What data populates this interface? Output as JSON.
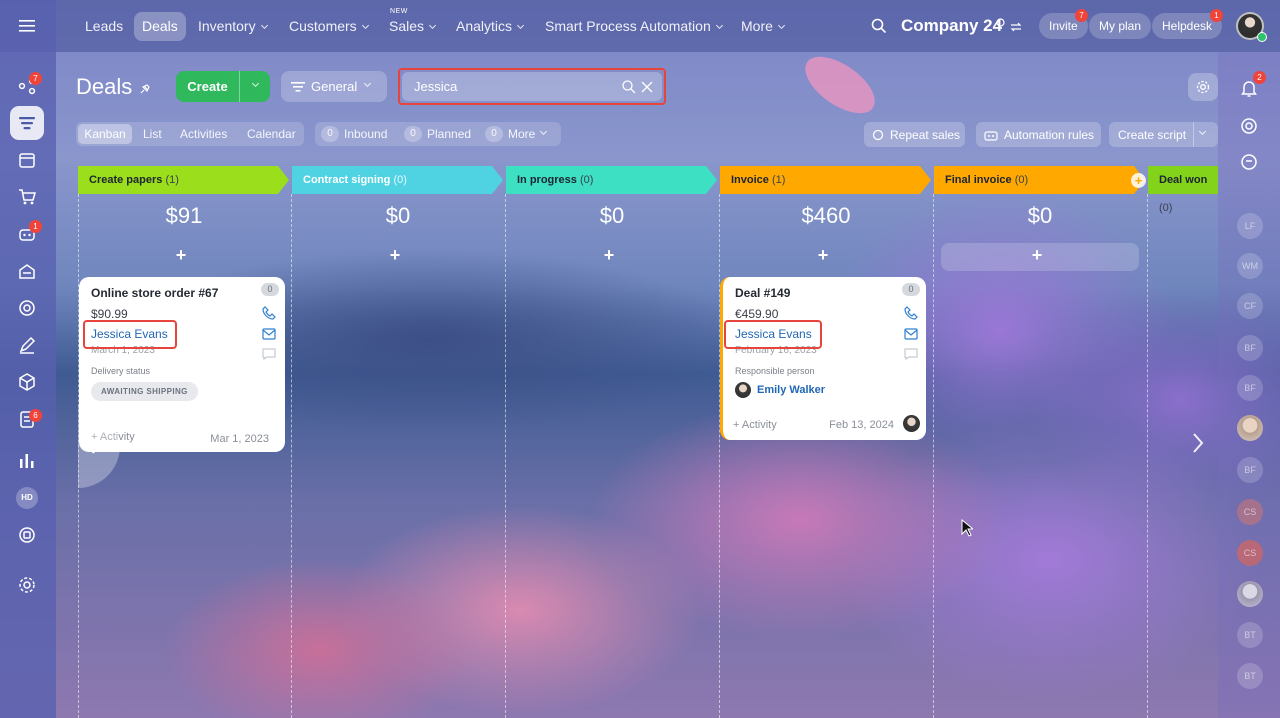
{
  "nav": {
    "items": [
      "Leads",
      "Deals",
      "Inventory",
      "Customers",
      "Sales",
      "Analytics",
      "Smart Process Automation",
      "More"
    ],
    "new_tag": "NEW"
  },
  "company": {
    "name": "Company 24",
    "invite": "Invite",
    "invite_badge": "7",
    "myplan": "My plan",
    "helpdesk": "Helpdesk",
    "helpdesk_badge": "1"
  },
  "sidebar": {
    "badges": {
      "activity": "7",
      "robots": "1",
      "tasks": "6"
    },
    "hd": "HD"
  },
  "page": {
    "title": "Deals",
    "create": "Create",
    "filter": "General",
    "search_value": "Jessica"
  },
  "views": {
    "tabs": [
      "Kanban",
      "List",
      "Activities",
      "Calendar"
    ],
    "counters": [
      {
        "count": "0",
        "label": "Inbound"
      },
      {
        "count": "0",
        "label": "Planned"
      },
      {
        "count": "0",
        "label": "More"
      }
    ]
  },
  "actions": {
    "repeat": "Repeat sales",
    "automation": "Automation rules",
    "script": "Create script"
  },
  "notif_badge": "2",
  "stages": [
    {
      "name": "Create papers",
      "count": "(1)",
      "color": "#9bde1c",
      "sum": "$91"
    },
    {
      "name": "Contract signing",
      "count": "(0)",
      "color": "#4fd3e2",
      "sum": "$0"
    },
    {
      "name": "In progress",
      "count": "(0)",
      "color": "#3ee0c4",
      "sum": "$0"
    },
    {
      "name": "Invoice",
      "count": "(1)",
      "color": "#ffa800",
      "sum": "$460"
    },
    {
      "name": "Final invoice",
      "count": "(0)",
      "color": "#ffa800",
      "sum": "$0"
    },
    {
      "name": "Deal won",
      "count": "(0)",
      "color": "#84d31b",
      "sum": ""
    }
  ],
  "cards": [
    {
      "title": "Online store order #67",
      "amount": "$90.99",
      "contact": "Jessica Evans",
      "date_top": "March 1, 2023",
      "label": "Delivery status",
      "status": "AWAITING SHIPPING",
      "activity": "+ Activity",
      "date": "Mar 1, 2023",
      "counter": "0"
    },
    {
      "title": "Deal #149",
      "amount": "€459.90",
      "contact": "Jessica Evans",
      "date_top": "February 16, 2023",
      "label": "Responsible person",
      "person": "Emily Walker",
      "activity": "+ Activity",
      "date": "Feb 13, 2024",
      "counter": "0"
    }
  ],
  "right_avatars": [
    "LF",
    "WM",
    "CF",
    "BF",
    "BF",
    "BF",
    "CS",
    "CS",
    "BT",
    "BT"
  ],
  "colors": {
    "highlight": "#e7453c",
    "create_green": "#2fb85c",
    "link_blue": "#2167b5"
  }
}
